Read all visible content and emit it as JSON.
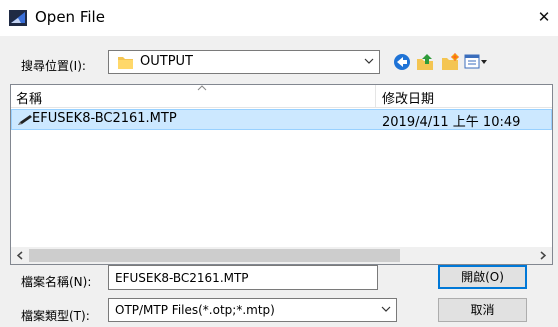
{
  "window": {
    "title": "Open File",
    "close_glyph": "✕",
    "icon": "app-icon"
  },
  "lookin": {
    "label": "搜尋位置(I):",
    "value": "OUTPUT",
    "folder_icon": "folder-icon"
  },
  "toolbar": {
    "icons": [
      "back-icon",
      "up-folder-icon",
      "new-folder-icon",
      "view-menu-icon"
    ]
  },
  "list": {
    "columns": [
      "名稱",
      "修改日期"
    ],
    "rows": [
      {
        "name": "EFUSEK8-BC2161.MTP",
        "date": "2019/4/11 上午 10:49",
        "selected": true
      }
    ]
  },
  "filename": {
    "label": "檔案名稱(N):",
    "value": "EFUSEK8-BC2161.MTP"
  },
  "filetype": {
    "label": "檔案類型(T):",
    "value": "OTP/MTP Files(*.otp;*.mtp)"
  },
  "buttons": {
    "open": "開啟(O)",
    "cancel": "取消"
  },
  "colors": {
    "selection": "#cce8ff",
    "selection_border": "#99d1ff",
    "focus_border": "#0078d7",
    "dialog_bg": "#f0f0f0"
  }
}
